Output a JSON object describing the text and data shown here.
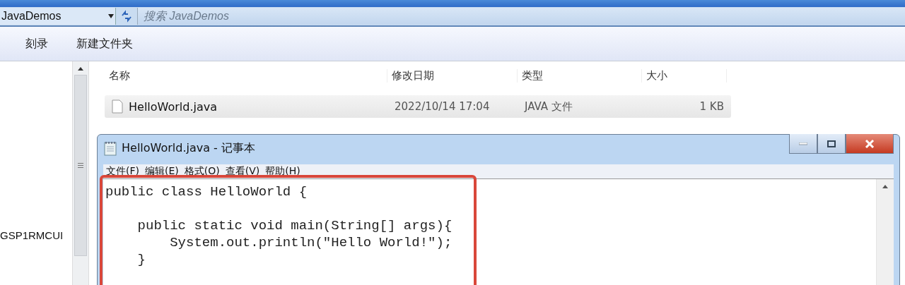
{
  "address_bar": {
    "path": "JavaDemos",
    "search_placeholder": "搜索 JavaDemos"
  },
  "toolbar": [
    "刻录",
    "新建文件夹"
  ],
  "nav_pane": {
    "items": [
      "GSP1RMCUI"
    ]
  },
  "file_list": {
    "columns": [
      "名称",
      "修改日期",
      "类型",
      "大小"
    ],
    "rows": [
      {
        "name": "HelloWorld.java",
        "modified": "2022/10/14 17:04",
        "type": "JAVA 文件",
        "size": "1 KB",
        "selected": true
      }
    ]
  },
  "notepad": {
    "title": "HelloWorld.java - 记事本",
    "menu": [
      "文件(F)",
      "编辑(E)",
      "格式(O)",
      "查看(V)",
      "帮助(H)"
    ],
    "text": "public class HelloWorld {\n\n    public static void main(String[] args){\n        System.out.println(\"Hello World!\");\n    }",
    "highlighted": true
  }
}
